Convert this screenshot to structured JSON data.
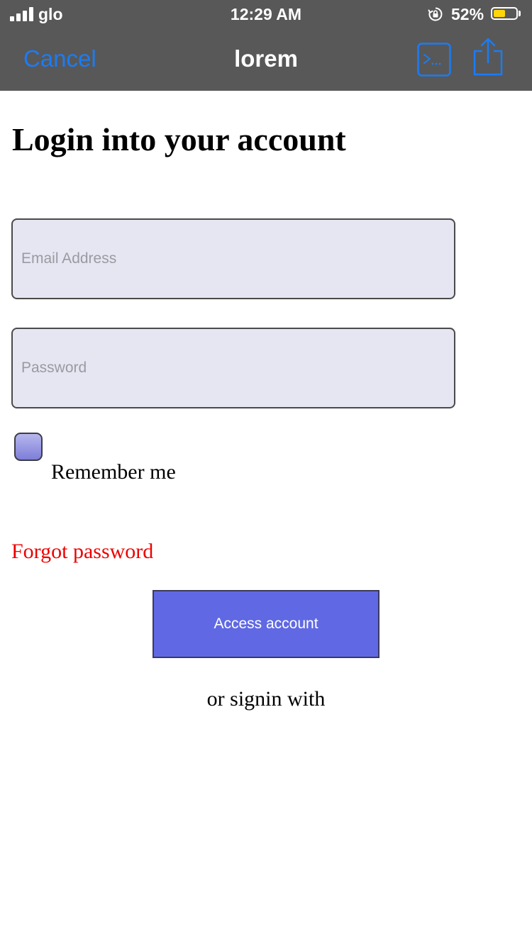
{
  "status_bar": {
    "carrier": "glo",
    "time": "12:29 AM",
    "battery_percent": "52%",
    "battery_level": 0.52,
    "icons": [
      "signal-bars-icon",
      "rotation-lock-icon",
      "battery-icon"
    ]
  },
  "nav": {
    "cancel_label": "Cancel",
    "title": "lorem",
    "icons": [
      "terminal-icon",
      "share-icon"
    ],
    "accent_color": "#1a7cf5",
    "background_color": "#585858"
  },
  "form": {
    "heading": "Login into your account",
    "email": {
      "placeholder": "Email Address",
      "value": ""
    },
    "password": {
      "placeholder": "Password",
      "value": ""
    },
    "remember_label": "Remember me",
    "remember_checked": false,
    "forgot_label": "Forgot password",
    "submit_label": "Access account",
    "alt_signin_label": "or signin with"
  },
  "colors": {
    "field_background": "#e6e6f2",
    "button_background": "#6069e3",
    "forgot_link": "#ee0000"
  }
}
